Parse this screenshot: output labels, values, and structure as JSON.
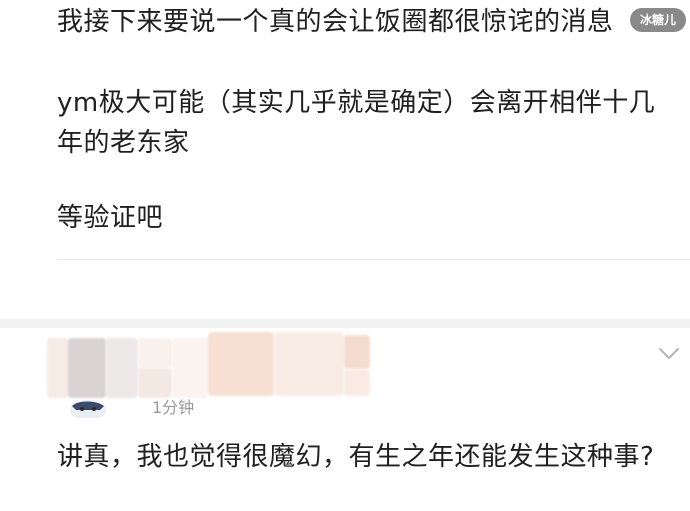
{
  "post": {
    "line1": "我接下来要说一个真的会让饭圈都很惊诧的消息",
    "line2": "ym极大可能（其实几乎就是确定）会离开相伴十几年的老东家",
    "line3": "等验证吧"
  },
  "watermark": {
    "text": "冰糖儿"
  },
  "comment": {
    "time": "1分钟",
    "text": "讲真，我也觉得很魔幻，有生之年还能发生这种事?"
  },
  "icons": {
    "expand": "chevron-down-icon",
    "avatar": "avatar"
  },
  "colors": {
    "text": "#202020",
    "muted": "#9a9a9a",
    "divider": "#e6e6e6",
    "band": "#f2f2f2"
  }
}
